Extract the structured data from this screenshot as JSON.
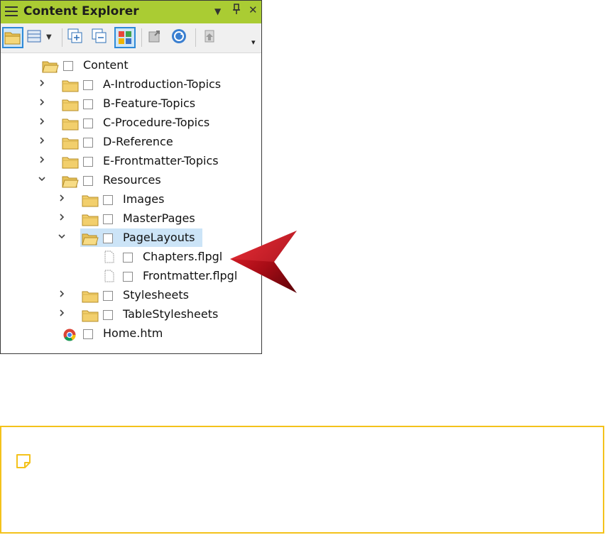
{
  "panel": {
    "title": "Content Explorer",
    "controls": {
      "dropdown": "▼",
      "pin": "ꟾ",
      "close": "✕"
    },
    "toolbar": {
      "buttons": [
        {
          "icon": "open-folder-icon",
          "selected": true
        },
        {
          "icon": "view-layout-icon",
          "selected": false
        },
        {
          "icon": "expand-all-icon",
          "selected": false
        },
        {
          "icon": "collapse-all-icon",
          "selected": false
        },
        {
          "icon": "show-files-icon",
          "selected": true
        },
        {
          "icon": "export-icon",
          "selected": false
        },
        {
          "icon": "refresh-icon",
          "selected": false
        },
        {
          "icon": "upload-icon",
          "selected": false
        }
      ],
      "overflow": "▾"
    }
  },
  "tree": [
    {
      "label": "Content",
      "level": 0,
      "type": "folder-open",
      "chevron": ""
    },
    {
      "label": "A-Introduction-Topics",
      "level": 1,
      "type": "folder",
      "chevron": ">"
    },
    {
      "label": "B-Feature-Topics",
      "level": 1,
      "type": "folder",
      "chevron": ">"
    },
    {
      "label": "C-Procedure-Topics",
      "level": 1,
      "type": "folder",
      "chevron": ">"
    },
    {
      "label": "D-Reference",
      "level": 1,
      "type": "folder",
      "chevron": ">"
    },
    {
      "label": "E-Frontmatter-Topics",
      "level": 1,
      "type": "folder",
      "chevron": ">"
    },
    {
      "label": "Resources",
      "level": 1,
      "type": "folder-open",
      "chevron": "v"
    },
    {
      "label": "Images",
      "level": 2,
      "type": "folder",
      "chevron": ">"
    },
    {
      "label": "MasterPages",
      "level": 2,
      "type": "folder",
      "chevron": ">"
    },
    {
      "label": "PageLayouts",
      "level": 2,
      "type": "folder-open",
      "chevron": "v",
      "highlighted": true
    },
    {
      "label": "Chapters.flpgl",
      "level": 3,
      "type": "file",
      "chevron": ""
    },
    {
      "label": "Frontmatter.flpgl",
      "level": 3,
      "type": "file",
      "chevron": ""
    },
    {
      "label": "Stylesheets",
      "level": 2,
      "type": "folder",
      "chevron": ">"
    },
    {
      "label": "TableStylesheets",
      "level": 2,
      "type": "folder",
      "chevron": ">"
    },
    {
      "label": "Home.htm",
      "level": 1,
      "type": "chrome",
      "chevron": ""
    }
  ],
  "callout": {
    "icon": "red-arrow-icon",
    "color": "#c0121a"
  },
  "note": {
    "icon": "note-icon",
    "border_color": "#f4c21b"
  }
}
